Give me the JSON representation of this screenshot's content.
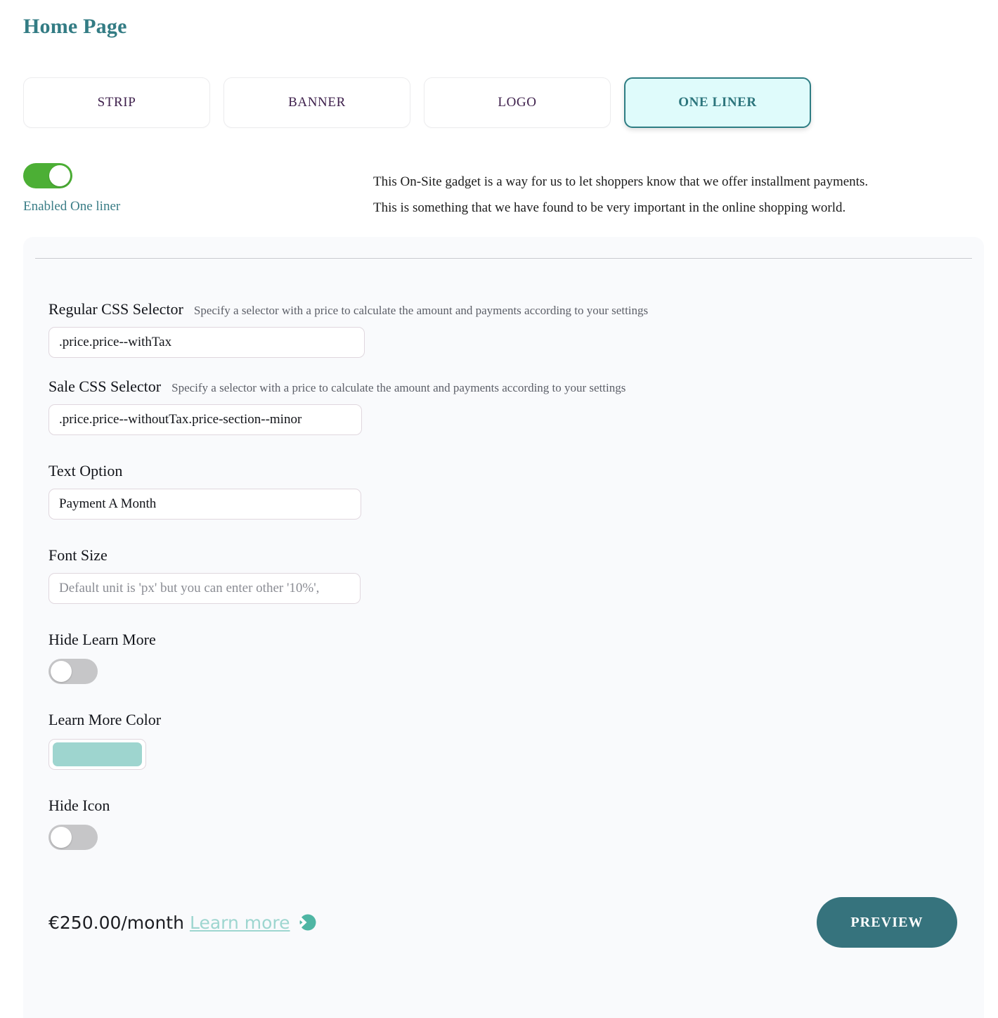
{
  "header": {
    "title": "Home Page",
    "title_color": "#337c84"
  },
  "tabs": [
    {
      "label": "STRIP",
      "active": false
    },
    {
      "label": "BANNER",
      "active": false
    },
    {
      "label": "LOGO",
      "active": false
    },
    {
      "label": "ONE LINER",
      "active": true
    }
  ],
  "enable": {
    "toggle_state": "on",
    "label": "Enabled One liner",
    "toggle_on_color": "#4caf35"
  },
  "description": {
    "line1": "This On-Site gadget is a way for us to let shoppers know that we offer installment payments.",
    "line2": "This is something that we have found to be very important in the online shopping world."
  },
  "form": {
    "regular_css_selector": {
      "label": "Regular CSS Selector",
      "hint": "Specify a selector with a price to calculate the amount and payments according to your settings",
      "value": ".price.price--withTax",
      "placeholder": ""
    },
    "sale_css_selector": {
      "label": "Sale CSS Selector",
      "hint": "Specify a selector with a price to calculate the amount and payments according to your settings",
      "value": ".price.price--withoutTax.price-section--minor",
      "placeholder": ""
    },
    "text_option": {
      "label": "Text Option",
      "value": "Payment A Month",
      "placeholder": ""
    },
    "font_size": {
      "label": "Font Size",
      "value": "",
      "placeholder": "Default unit is 'px' but you can enter other '10%',"
    },
    "hide_learn_more": {
      "label": "Hide Learn More",
      "toggle_state": "off"
    },
    "learn_more_color": {
      "label": "Learn More Color",
      "value": "#9ed5cf"
    },
    "hide_icon": {
      "label": "Hide Icon",
      "toggle_state": "off"
    }
  },
  "preview": {
    "price_text": "€250.00/month",
    "learn_more_text": "Learn more",
    "icon_color": "#4fb6a4",
    "button_label": "PREVIEW",
    "button_color": "#36737d"
  }
}
